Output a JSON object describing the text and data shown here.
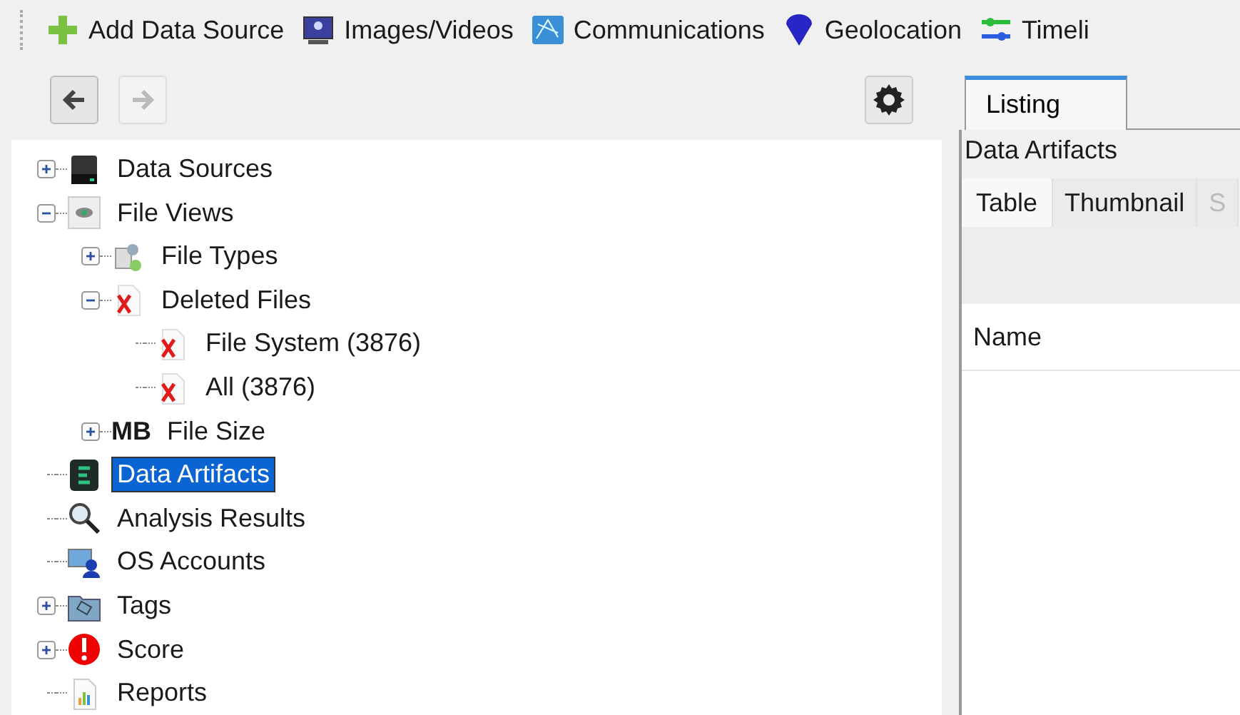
{
  "toolbar": [
    {
      "kind": "add",
      "label": "Add Data Source"
    },
    {
      "kind": "images",
      "label": "Images/Videos"
    },
    {
      "kind": "communications",
      "label": "Communications"
    },
    {
      "kind": "geolocation",
      "label": "Geolocation"
    },
    {
      "kind": "timeline",
      "label": "Timeli"
    }
  ],
  "navigation": {
    "back": {
      "disabled": false
    },
    "forward": {
      "disabled": true
    }
  },
  "tree": [
    {
      "kind": "drive",
      "label": "Data Sources",
      "expanded": false,
      "selected": false
    },
    {
      "kind": "eye",
      "label": "File Views",
      "expanded": true,
      "selected": false,
      "children": [
        {
          "kind": "types",
          "label": "File Types",
          "expanded": false,
          "selected": false
        },
        {
          "kind": "deleted",
          "label": "Deleted Files",
          "expanded": true,
          "selected": false,
          "children": [
            {
              "kind": "deleted",
              "label": "File System (3876)",
              "selected": false
            },
            {
              "kind": "deleted",
              "label": "All (3876)",
              "selected": false
            }
          ]
        },
        {
          "kind": "size",
          "label": "File Size",
          "icon_text": "MB",
          "expanded": false,
          "selected": false
        }
      ]
    },
    {
      "kind": "artifacts",
      "label": "Data Artifacts",
      "selected": true
    },
    {
      "kind": "search",
      "label": "Analysis Results",
      "selected": false
    },
    {
      "kind": "accounts",
      "label": "OS Accounts",
      "selected": false
    },
    {
      "kind": "tags",
      "label": "Tags",
      "expanded": false,
      "selected": false
    },
    {
      "kind": "score",
      "label": "Score",
      "expanded": false,
      "selected": false
    },
    {
      "kind": "reports",
      "label": "Reports",
      "selected": false
    }
  ],
  "main_tabs": [
    {
      "label": "Listing",
      "selected": true
    }
  ],
  "listing": {
    "title": "Data Artifacts",
    "view_tabs": [
      {
        "label": "Table",
        "selected": true
      },
      {
        "label": "Thumbnail",
        "selected": false
      },
      {
        "label": "S",
        "selected": false
      }
    ],
    "columns": [
      "Name"
    ]
  }
}
